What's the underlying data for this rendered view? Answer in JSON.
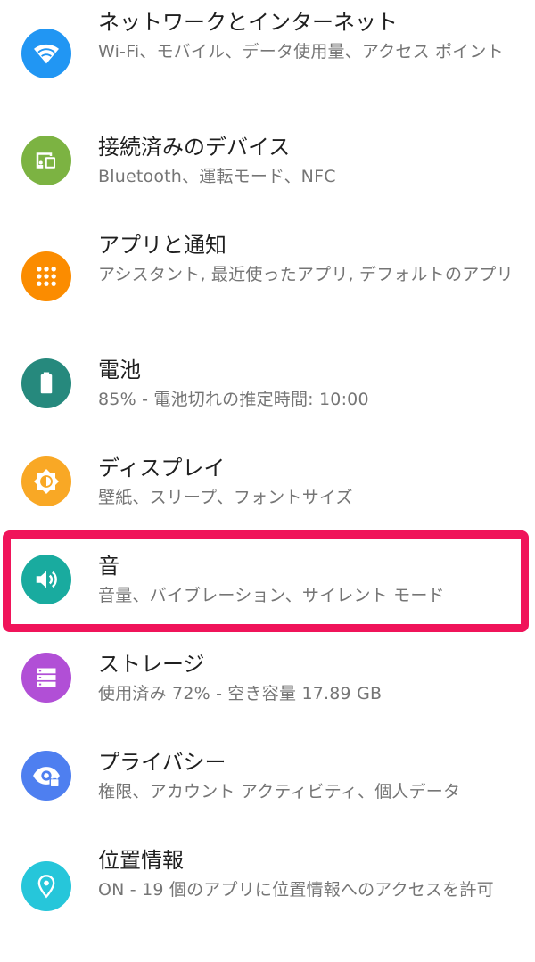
{
  "settings": {
    "items": [
      {
        "title": "ネットワークとインターネット",
        "subtitle": "Wi-Fi、モバイル、データ使用量、アクセス ポイント",
        "icon": "wifi-icon",
        "color": "#2196f3"
      },
      {
        "title": "接続済みのデバイス",
        "subtitle": "Bluetooth、運転モード、NFC",
        "icon": "connected-devices-icon",
        "color": "#7cb342"
      },
      {
        "title": "アプリと通知",
        "subtitle": "アシスタント, 最近使ったアプリ, デフォルトのアプリ",
        "icon": "apps-grid-icon",
        "color": "#fb8c00"
      },
      {
        "title": "電池",
        "subtitle": "85% - 電池切れの推定時間: 10:00",
        "icon": "battery-icon",
        "color": "#26897d"
      },
      {
        "title": "ディスプレイ",
        "subtitle": "壁紙、スリープ、フォントサイズ",
        "icon": "brightness-icon",
        "color": "#f9a825"
      },
      {
        "title": "音",
        "subtitle": "音量、バイブレーション、サイレント モード",
        "icon": "volume-icon",
        "color": "#19ab9f"
      },
      {
        "title": "ストレージ",
        "subtitle": "使用済み 72% - 空き容量 17.89 GB",
        "icon": "storage-icon",
        "color": "#b14fd6"
      },
      {
        "title": "プライバシー",
        "subtitle": "権限、アカウント アクティビティ、個人データ",
        "icon": "privacy-eye-icon",
        "color": "#4e7ff0"
      },
      {
        "title": "位置情報",
        "subtitle": "ON - 19 個のアプリに位置情報へのアクセスを許可",
        "icon": "location-pin-icon",
        "color": "#26c6da"
      }
    ],
    "highlighted_item": "音",
    "highlight_color": "#f0145a"
  }
}
